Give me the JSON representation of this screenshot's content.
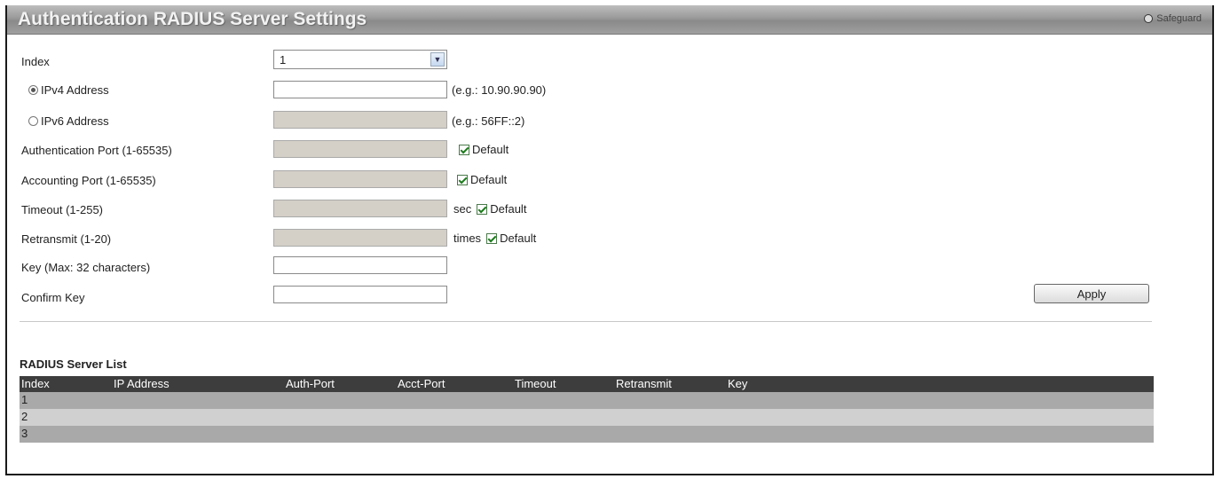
{
  "header": {
    "title": "Authentication RADIUS Server Settings",
    "safeguard": "Safeguard"
  },
  "form": {
    "index": {
      "label": "Index",
      "value": "1"
    },
    "ipv4": {
      "label": "IPv4 Address",
      "hint": "(e.g.: 10.90.90.90)",
      "selected": true
    },
    "ipv6": {
      "label": "IPv6 Address",
      "hint": "(e.g.: 56FF::2)",
      "selected": false
    },
    "auth_port": {
      "label": "Authentication Port (1-65535)",
      "default_label": "Default"
    },
    "acct_port": {
      "label": "Accounting Port (1-65535)",
      "default_label": "Default"
    },
    "timeout": {
      "label": "Timeout (1-255)",
      "unit": "sec",
      "default_label": "Default"
    },
    "retransmit": {
      "label": "Retransmit (1-20)",
      "unit": "times",
      "default_label": "Default"
    },
    "key": {
      "label": "Key (Max: 32 characters)"
    },
    "confirm_key": {
      "label": "Confirm Key"
    },
    "apply_label": "Apply"
  },
  "list": {
    "title": "RADIUS Server List",
    "columns": [
      "Index",
      "IP Address",
      "Auth-Port",
      "Acct-Port",
      "Timeout",
      "Retransmit",
      "Key"
    ],
    "rows": [
      {
        "index": "1"
      },
      {
        "index": "2"
      },
      {
        "index": "3"
      }
    ]
  }
}
